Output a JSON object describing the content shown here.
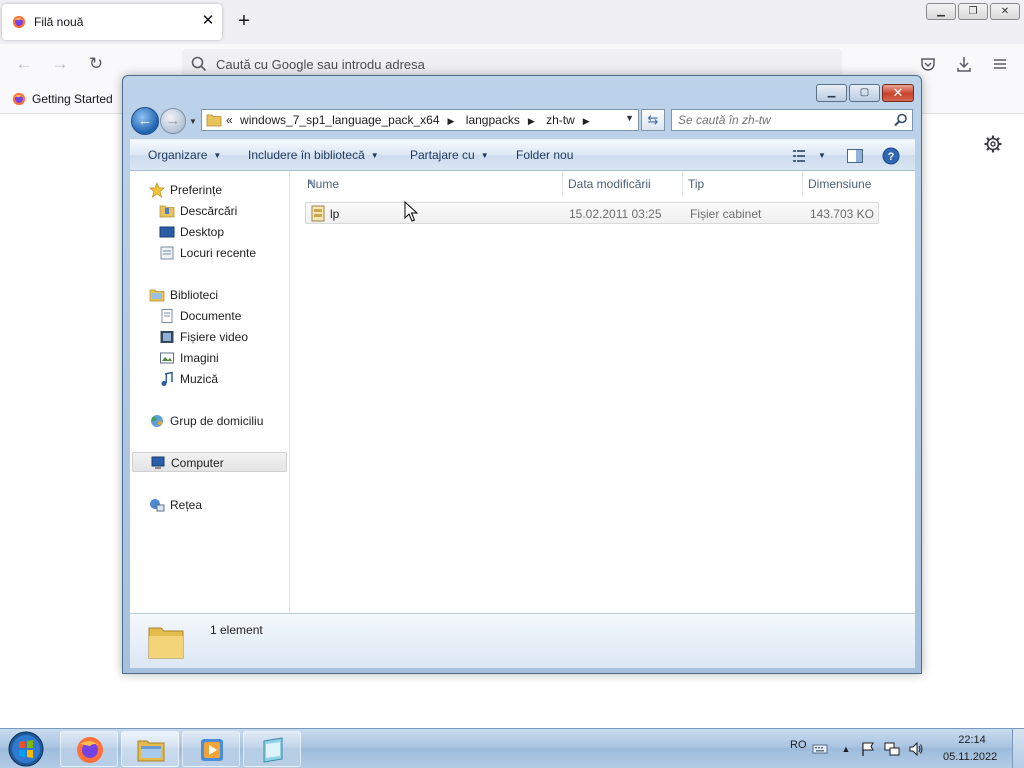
{
  "browser": {
    "tab": {
      "title": "Filă nouă",
      "close_glyph": "✕"
    },
    "new_tab_glyph": "+",
    "window_controls": {
      "minimize": "▁",
      "restore": "❐",
      "close": "✕"
    },
    "nav": {
      "back_glyph": "←",
      "forward_glyph": "→",
      "reload_glyph": "↻"
    },
    "urlbar": {
      "placeholder": "Caută cu Google sau introdu adresa"
    },
    "bookmarks": [
      {
        "label": "Getting Started"
      }
    ],
    "icons": {
      "tab": "firefox-icon",
      "search": "search-icon",
      "pocket": "pocket-icon",
      "downloads": "download-icon",
      "menu": "hamburger-menu-icon",
      "settings": "gear-icon"
    }
  },
  "explorer": {
    "caption": {
      "minimize": "▁",
      "maximize": "▢",
      "close": "✕"
    },
    "address": {
      "prefix": "«",
      "crumbs": [
        "windows_7_sp1_language_pack_x64",
        "langpacks",
        "zh-tw"
      ],
      "separator": "▶"
    },
    "search": {
      "placeholder": "Se caută în zh-tw"
    },
    "commands": {
      "organize": "Organizare",
      "include_library": "Includere în bibliotecă",
      "share_with": "Partajare cu",
      "new_folder": "Folder nou"
    },
    "navpane": {
      "favorites": {
        "label": "Preferințe",
        "items": [
          "Descărcări",
          "Desktop",
          "Locuri recente"
        ]
      },
      "libraries": {
        "label": "Biblioteci",
        "items": [
          "Documente",
          "Fișiere video",
          "Imagini",
          "Muzică"
        ]
      },
      "homegroup": "Grup de domiciliu",
      "computer": "Computer",
      "network": "Rețea"
    },
    "columns": {
      "name": "Nume",
      "date": "Data modificării",
      "type": "Tip",
      "size": "Dimensiune"
    },
    "files": [
      {
        "name": "lp",
        "date": "15.02.2011 03:25",
        "type": "Fișier cabinet",
        "size": "143.703 KO"
      }
    ],
    "details": {
      "count": "1 element"
    }
  },
  "taskbar": {
    "language": "RO",
    "clock": {
      "time": "22:14",
      "date": "05.11.2022"
    },
    "pinned": [
      "firefox-icon",
      "explorer-icon",
      "media-player-icon",
      "app-icon"
    ]
  }
}
